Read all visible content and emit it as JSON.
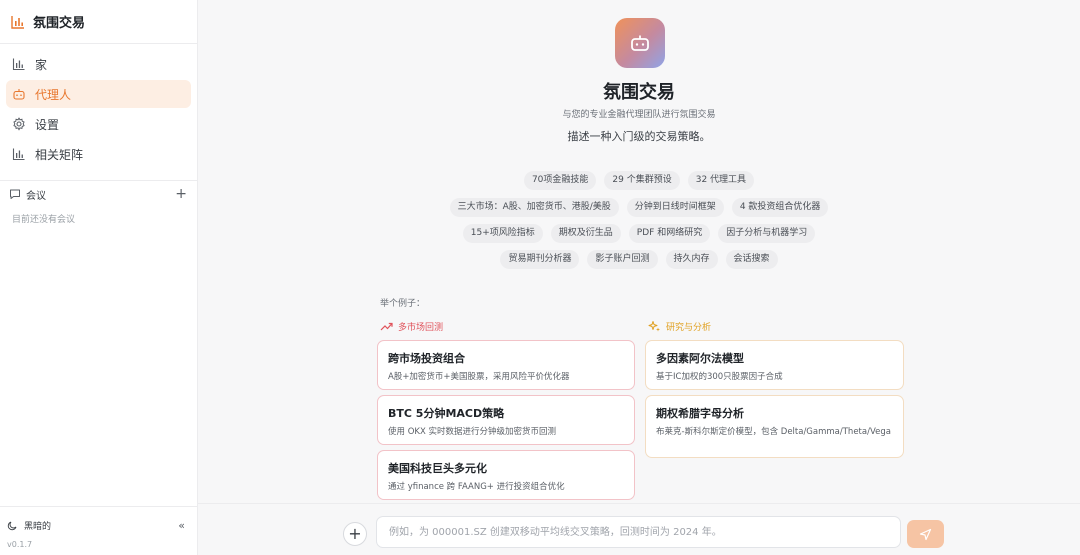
{
  "sidebar": {
    "brand": "氛围交易",
    "items": [
      {
        "label": "家",
        "icon": "bar-chart-icon"
      },
      {
        "label": "代理人",
        "icon": "bot-icon"
      },
      {
        "label": "设置",
        "icon": "gear-icon"
      },
      {
        "label": "相关矩阵",
        "icon": "bar-chart-icon"
      }
    ],
    "active_index": 1,
    "conversations_title": "会议",
    "conversations_add": "+",
    "conversations_empty": "目前还没有会议",
    "theme_label": "黑暗的",
    "collapse_label": "«",
    "version": "v0.1.7"
  },
  "hero": {
    "title": "氛围交易",
    "subtitle": "与您的专业金融代理团队进行氛围交易",
    "description": "描述一种入门级的交易策略。"
  },
  "chips": [
    [
      "70项金融技能",
      "29 个集群预设",
      "32 代理工具"
    ],
    [
      "三大市场：A股、加密货币、港股/美股",
      "分钟到日线时间框架",
      "4 款投资组合优化器"
    ],
    [
      "15+项风险指标",
      "期权及衍生品",
      "PDF 和网络研究",
      "因子分析与机器学习"
    ],
    [
      "贸易期刊分析器",
      "影子账户回测",
      "持久内存",
      "会话搜索"
    ]
  ],
  "examples": {
    "label": "举个例子：",
    "left": {
      "title": "多市场回测",
      "cards": [
        {
          "title": "跨市场投资组合",
          "desc": "A股+加密货币+美国股票，采用风险平价优化器"
        },
        {
          "title": "BTC 5分钟MACD策略",
          "desc": "使用 OKX 实时数据进行分钟级加密货币回测"
        },
        {
          "title": "美国科技巨头多元化",
          "desc": "通过 yfinance 跨 FAANG+ 进行投资组合优化"
        }
      ]
    },
    "right": {
      "title": "研究与分析",
      "cards": [
        {
          "title": "多因素阿尔法模型",
          "desc": "基于IC加权的300只股票因子合成"
        },
        {
          "title": "期权希腊字母分析",
          "desc": "布莱克-斯科尔斯定价模型，包含 Delta/Gamma/Theta/Vega"
        }
      ]
    }
  },
  "composer": {
    "placeholder": "例如，为 000001.SZ 创建双移动平均线交叉策略，回测时间为 2024 年。",
    "value": "",
    "add_label": "+"
  },
  "colors": {
    "accent": "#e8772e",
    "left_heading": "#e0525a",
    "right_heading": "#e0a020"
  }
}
